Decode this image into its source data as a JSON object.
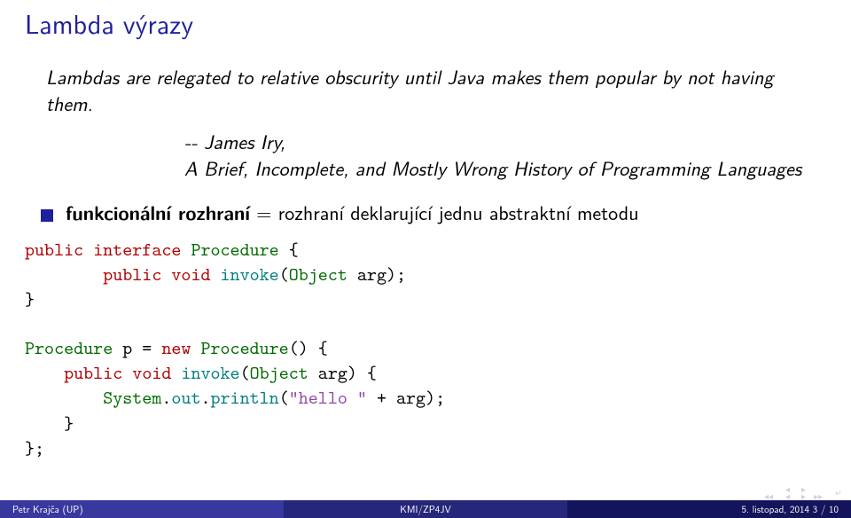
{
  "title": "Lambda výrazy",
  "quote": {
    "body": "Lambdas are relegated to relative obscurity until Java makes them popular by not having them.",
    "author": "-- James Iry,",
    "source": "A Brief, Incomplete, and Mostly Wrong History of Programming Languages"
  },
  "bullet": {
    "bold": "funkcionální rozhraní",
    "rest": " = rozhraní deklarující jednu abstraktní metodu"
  },
  "code1": {
    "kw_public1": "public",
    "kw_interface": "interface",
    "type_proc": "Procedure",
    "brace_open": " {",
    "indent": "        ",
    "kw_public2": "public",
    "kw_void": "void",
    "teal_invoke": "invoke",
    "paren_open": "(",
    "type_obj": "Object",
    "arg_rest": " arg);",
    "brace_close": "}"
  },
  "code2": {
    "type_proc": "Procedure",
    "var_eq": " p = ",
    "kw_new": "new",
    "sp": " ",
    "ctor": "Procedure",
    "paren": "() {",
    "indent1": "    ",
    "kw_public": "public",
    "kw_void": "void",
    "teal_invoke": "invoke",
    "paren_open": "(",
    "type_obj": "Object",
    "arg_rest": " arg) {",
    "indent2": "        ",
    "sys": "System",
    "dot1": ".",
    "out": "out",
    "dot2": ".",
    "println": "println",
    "po": "(",
    "str": "\"hello \"",
    "plus": " + arg);",
    "close1": "    }",
    "close2": "};"
  },
  "footer": {
    "left": "Petr Krajča (UP)",
    "mid": "KMI/ZP4JV",
    "right": "5. listopad, 2014      3 / 10"
  }
}
